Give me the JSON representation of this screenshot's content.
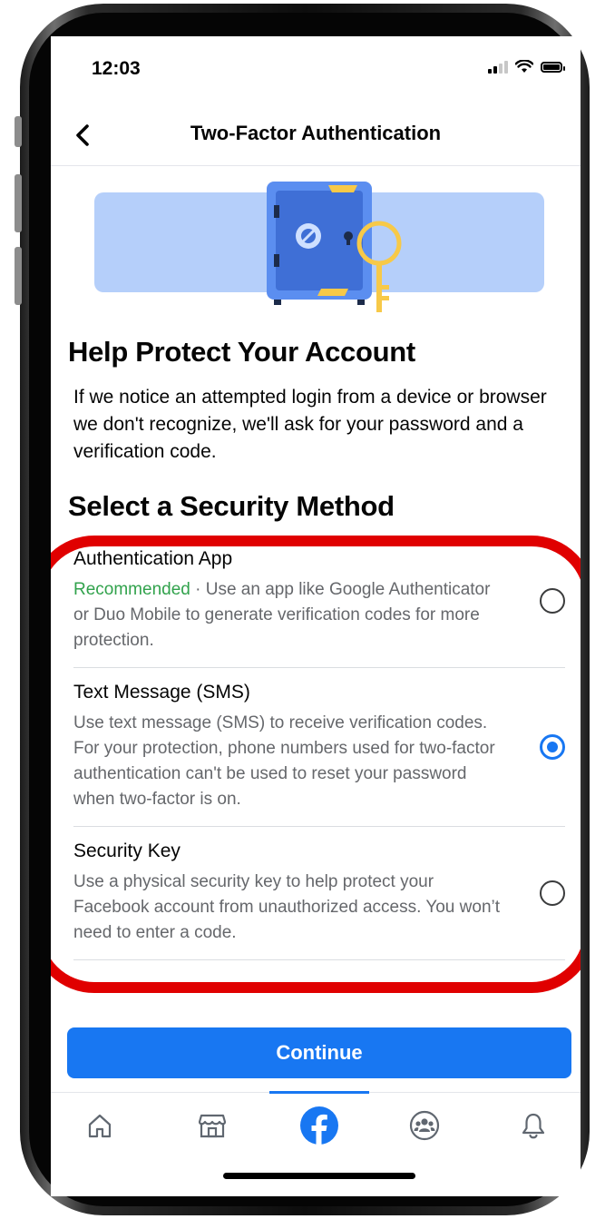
{
  "status_bar": {
    "time": "12:03"
  },
  "header": {
    "title": "Two-Factor Authentication"
  },
  "main": {
    "heading": "Help Protect Your Account",
    "intro": "If we notice an attempted login from a device or browser we don't recognize, we'll ask for your password and a verification code.",
    "section_heading": "Select a Security Method",
    "options": [
      {
        "title": "Authentication App",
        "badge": "Recommended",
        "separator": " · ",
        "description": "Use an app like Google Authenticator or Duo Mobile to generate verification codes for more protection.",
        "selected": false
      },
      {
        "title": "Text Message (SMS)",
        "description": "Use text message (SMS) to receive verification codes. For your protection, phone numbers used for two-factor authentication can't be used to reset your password when two-factor is on.",
        "selected": true
      },
      {
        "title": "Security Key",
        "description": "Use a physical security key to help protect your Facebook account from unauthorized access. You won’t need to enter a code.",
        "selected": false
      }
    ],
    "continue_label": "Continue"
  },
  "tabbar": {
    "tabs": [
      {
        "icon": "home-icon",
        "active": false
      },
      {
        "icon": "marketplace-icon",
        "active": false
      },
      {
        "icon": "facebook-icon",
        "active": true
      },
      {
        "icon": "groups-icon",
        "active": false
      },
      {
        "icon": "notifications-icon",
        "active": false
      }
    ]
  },
  "colors": {
    "accent": "#1877f2",
    "recommended": "#31a24c",
    "highlight": "#e00000",
    "secondary_text": "#65676b"
  }
}
